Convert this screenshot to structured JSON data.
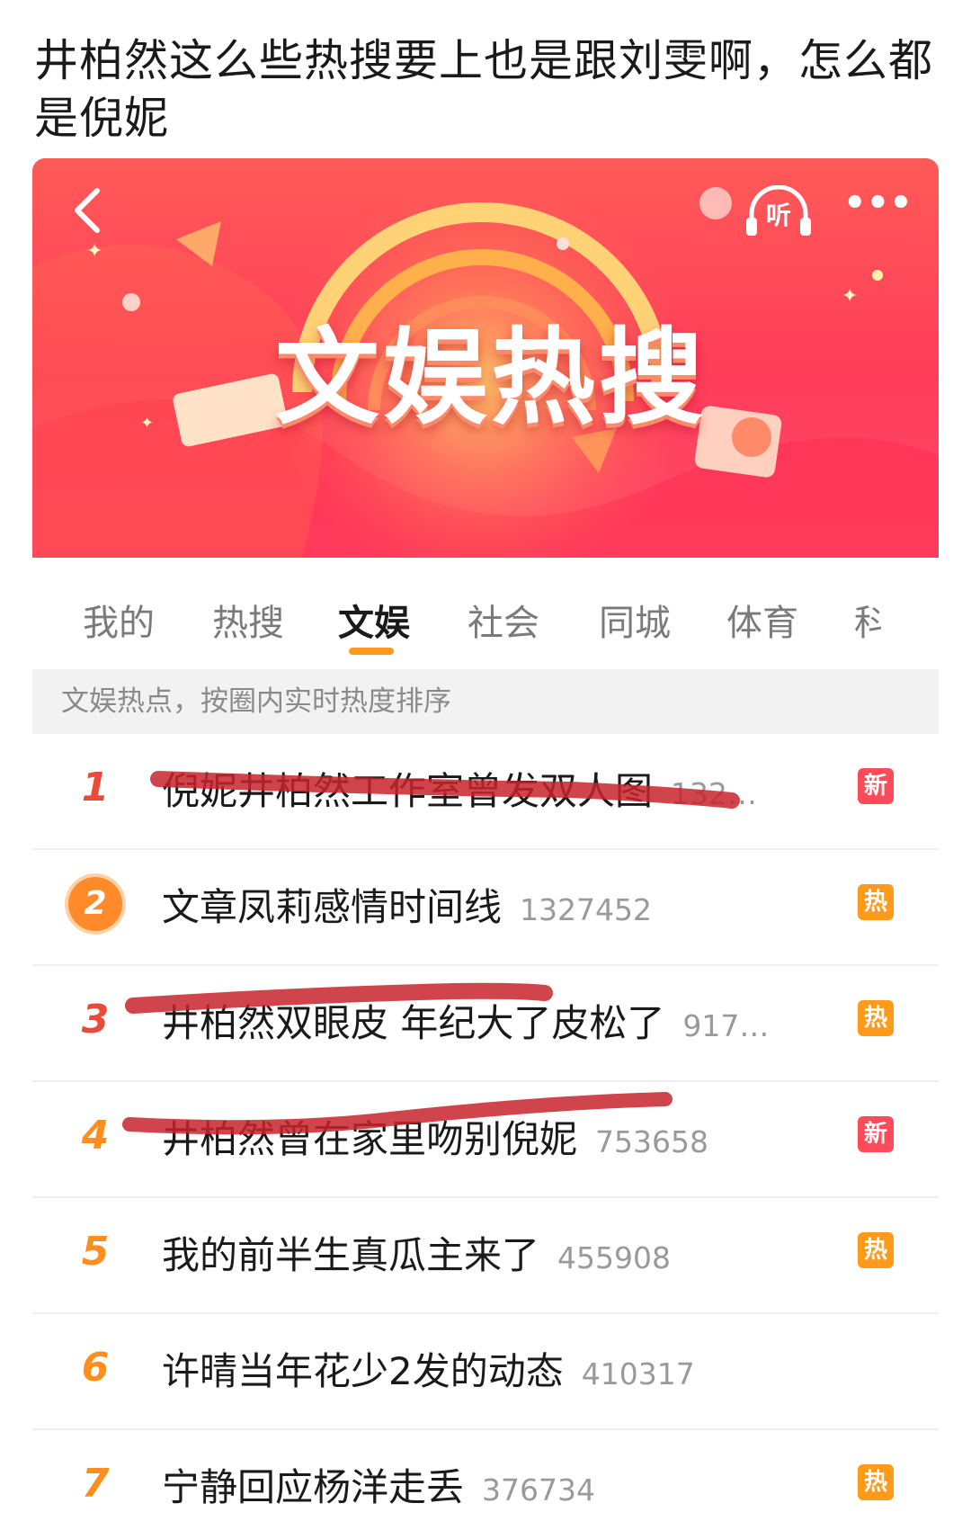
{
  "post": {
    "title": "井柏然这么些热搜要上也是跟刘雯啊，怎么都是倪妮"
  },
  "banner": {
    "title": "文娱热搜",
    "listen_label": "听",
    "more_label": "•••"
  },
  "tabs": [
    {
      "label": "我的",
      "active": false
    },
    {
      "label": "热搜",
      "active": false
    },
    {
      "label": "文娱",
      "active": true
    },
    {
      "label": "社会",
      "active": false
    },
    {
      "label": "同城",
      "active": false
    },
    {
      "label": "体育",
      "active": false
    },
    {
      "label": "科",
      "active": false
    }
  ],
  "info_bar": "文娱热点，按圈内实时热度排序",
  "list": [
    {
      "rank": "1",
      "title": "倪妮井柏然工作室曾发双人图",
      "count": "132…",
      "badge": "新",
      "badge_type": "new"
    },
    {
      "rank": "2",
      "title": "文章凤莉感情时间线",
      "count": "1327452",
      "badge": "热",
      "badge_type": "hot"
    },
    {
      "rank": "3",
      "title": "井柏然双眼皮 年纪大了皮松了",
      "count": "917…",
      "badge": "热",
      "badge_type": "hot"
    },
    {
      "rank": "4",
      "title": "井柏然曾在家里吻别倪妮",
      "count": "753658",
      "badge": "新",
      "badge_type": "new"
    },
    {
      "rank": "5",
      "title": "我的前半生真瓜主来了",
      "count": "455908",
      "badge": "热",
      "badge_type": "hot"
    },
    {
      "rank": "6",
      "title": "许晴当年花少2发的动态",
      "count": "410317",
      "badge": "",
      "badge_type": ""
    },
    {
      "rank": "7",
      "title": "宁静回应杨洋走丢",
      "count": "376734",
      "badge": "热",
      "badge_type": "hot"
    }
  ],
  "colors": {
    "accent": "#ff9a1e",
    "banner_red": "#ff3d5a",
    "badge_new": "#ff4a5a",
    "badge_hot": "#ff9a1a",
    "scribble": "#c8242c"
  }
}
